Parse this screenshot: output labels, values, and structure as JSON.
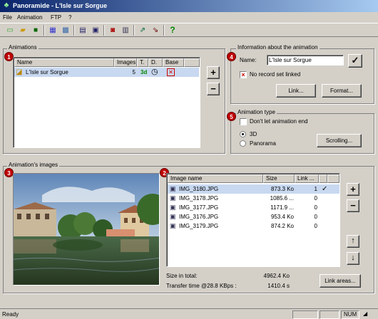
{
  "window": {
    "title": "Panoramide - L'Isle sur Sorgue"
  },
  "menu": [
    "File",
    "Animation",
    "FTP",
    "?"
  ],
  "toolbar": {
    "icons": [
      "new-icon",
      "open-icon",
      "save-icon",
      "grid-icon",
      "map-icon",
      "list-icon",
      "window-icon",
      "camera-icon",
      "film-icon",
      "export-icon",
      "import-icon",
      "help-icon"
    ],
    "help_glyph": "?"
  },
  "animations": {
    "group_label": "Animations",
    "badge": "1",
    "columns": [
      "Name",
      "Images",
      "T.",
      "D.",
      "Base"
    ],
    "rows": [
      {
        "name": "L'Isle sur Sorgue",
        "images": "5",
        "type": "3d",
        "duration": "◷",
        "base": "✕"
      }
    ],
    "add_label": "+",
    "remove_label": "−"
  },
  "info": {
    "group_label": "Information about the animation",
    "badge": "4",
    "name_label": "Name:",
    "name_value": "L'Isle sur Sorgue",
    "ok_glyph": "✓",
    "record_label": "No record set linked",
    "link_button": "Link...",
    "format_button": "Format..."
  },
  "anim_type": {
    "group_label": "Animation type",
    "badge": "5",
    "dont_let_end_label": "Don't let animation end",
    "options": [
      "3D",
      "Panorama"
    ],
    "selected": "3D",
    "scrolling_button": "Scrolling..."
  },
  "images": {
    "group_label": "Animation's images",
    "preview_badge": "3",
    "list_badge": "2",
    "columns": [
      "Image name",
      "Size",
      "Link ...",
      ""
    ],
    "rows": [
      {
        "name": "IMG_3180.JPG",
        "size": "873.3 Ko",
        "link": "1",
        "check": "✓"
      },
      {
        "name": "IMG_3178.JPG",
        "size": "1085.6 ...",
        "link": "0",
        "check": ""
      },
      {
        "name": "IMG_3177.JPG",
        "size": "1171.9 ...",
        "link": "0",
        "check": ""
      },
      {
        "name": "IMG_3176.JPG",
        "size": "953.4 Ko",
        "link": "0",
        "check": ""
      },
      {
        "name": "IMG_3179.JPG",
        "size": "874.2 Ko",
        "link": "0",
        "check": ""
      }
    ],
    "add_label": "+",
    "remove_label": "−",
    "up_label": "↑",
    "down_label": "↓",
    "size_total_label": "Size in total:",
    "size_total_value": "4962.4 Ko",
    "transfer_label": "Transfer time @28.8 KBps :",
    "transfer_value": "1410.4 s",
    "link_areas_button": "Link areas..."
  },
  "status": {
    "text": "Ready",
    "num": "NUM"
  },
  "colors": {
    "badge": "#c00000",
    "selection": "#c8d8f0",
    "title_start": "#0a246a",
    "title_end": "#a6caf0"
  }
}
